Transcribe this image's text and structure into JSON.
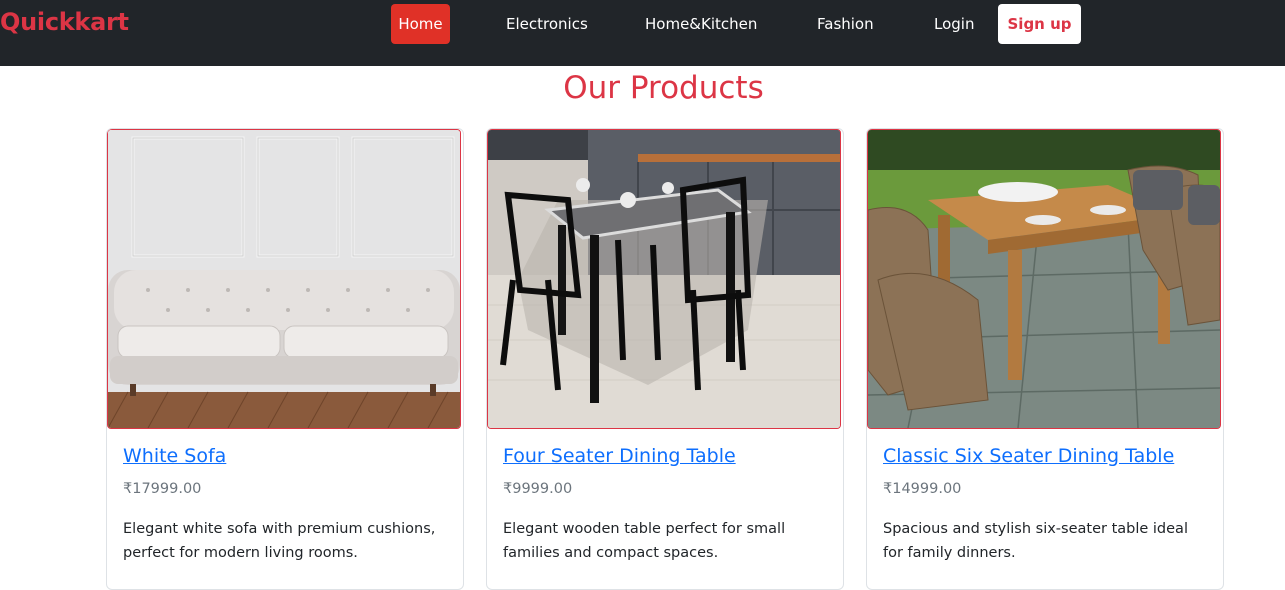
{
  "navbar": {
    "brand": "Quickkart",
    "links": [
      "Home",
      "Electronics",
      "Home&Kitchen",
      "Fashion",
      "Login"
    ],
    "signup_label": "Sign up",
    "colors": {
      "background": "#212529",
      "brand": "#dc3545",
      "active": "#e03127"
    }
  },
  "main": {
    "title": "Our Products",
    "products": [
      {
        "name": "White Sofa",
        "price": "₹17999.00",
        "description": "Elegant white sofa with premium cushions, perfect for modern living rooms."
      },
      {
        "name": "Four Seater Dining Table",
        "price": "₹9999.00",
        "description": "Elegant wooden table perfect for small families and compact spaces."
      },
      {
        "name": "Classic Six Seater Dining Table",
        "price": "₹14999.00",
        "description": "Spacious and stylish six-seater table ideal for family dinners."
      }
    ]
  }
}
